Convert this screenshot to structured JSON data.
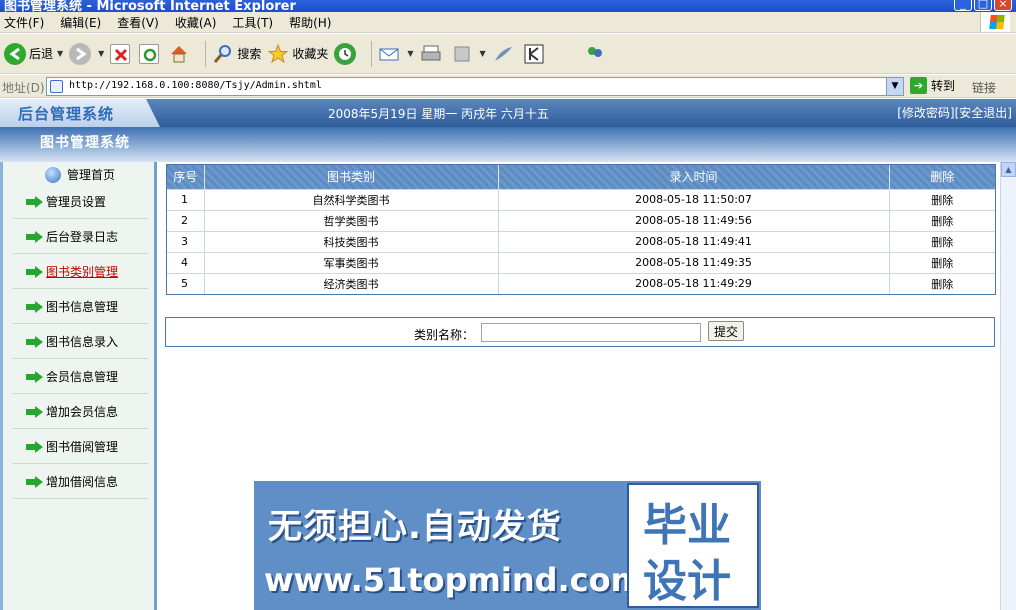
{
  "window": {
    "title": "图书管理系统 - Microsoft Internet Explorer"
  },
  "menubar": {
    "items": [
      "文件(F)",
      "编辑(E)",
      "查看(V)",
      "收藏(A)",
      "工具(T)",
      "帮助(H)"
    ]
  },
  "toolbar": {
    "back": "后退",
    "search": "搜索",
    "favorites": "收藏夹"
  },
  "address": {
    "label": "地址(D)",
    "url": "http://192.168.0.100:8080/Tsjy/Admin.shtml",
    "go": "转到",
    "links": "链接"
  },
  "header": {
    "tab": "后台管理系统",
    "date": "2008年5月19日 星期一 丙戌年 六月十五",
    "change_password": "[修改密码]",
    "logout": "[安全退出]",
    "system": "图书管理系统"
  },
  "sidebar": {
    "home": "管理首页",
    "items": [
      "管理员设置",
      "后台登录日志",
      "图书类别管理",
      "图书信息管理",
      "图书信息录入",
      "会员信息管理",
      "增加会员信息",
      "图书借阅管理",
      "增加借阅信息"
    ],
    "active_index": 2
  },
  "table": {
    "headers": [
      "序号",
      "图书类别",
      "录入时间",
      "删除"
    ],
    "rows": [
      {
        "no": "1",
        "category": "自然科学类图书",
        "time": "2008-05-18 11:50:07",
        "del": "删除"
      },
      {
        "no": "2",
        "category": "哲学类图书",
        "time": "2008-05-18 11:49:56",
        "del": "删除"
      },
      {
        "no": "3",
        "category": "科技类图书",
        "time": "2008-05-18 11:49:41",
        "del": "删除"
      },
      {
        "no": "4",
        "category": "军事类图书",
        "time": "2008-05-18 11:49:35",
        "del": "删除"
      },
      {
        "no": "5",
        "category": "经济类图书",
        "time": "2008-05-18 11:49:29",
        "del": "删除"
      }
    ]
  },
  "form": {
    "label": "类别名称：",
    "input_value": "",
    "submit": "提交"
  },
  "watermark": {
    "line1": "无须担心.自动发货",
    "line2": "www.51topmind.com",
    "right1": "毕业",
    "right2": "设计"
  },
  "colors": {
    "accent": "#2f5d9a",
    "table_header": "#6a98cb",
    "nav_arrow": "#27a632",
    "active_nav": "#cc0000"
  }
}
